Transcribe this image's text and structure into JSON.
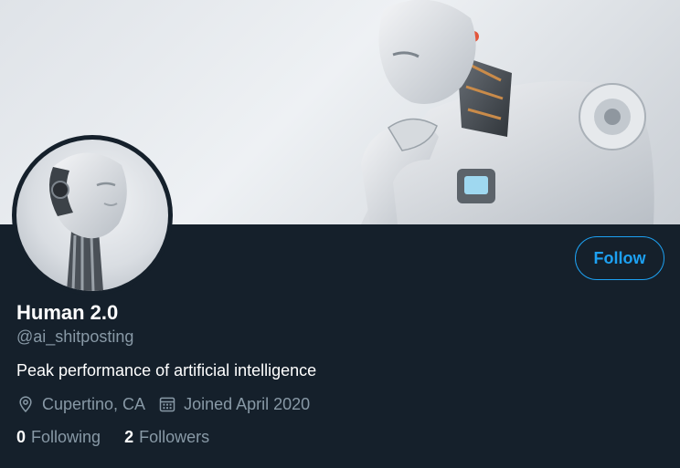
{
  "profile": {
    "display_name": "Human 2.0",
    "handle": "@ai_shitposting",
    "bio": "Peak performance of artificial intelligence",
    "location": "Cupertino, CA",
    "joined": "Joined April 2020"
  },
  "actions": {
    "follow_label": "Follow"
  },
  "stats": {
    "following_count": "0",
    "following_label": "Following",
    "followers_count": "2",
    "followers_label": "Followers"
  },
  "icons": {
    "location": "location-pin-icon",
    "joined": "calendar-icon"
  },
  "colors": {
    "background": "#15202b",
    "accent": "#1da1f2",
    "secondary_text": "#8899a6",
    "primary_text": "#ffffff"
  }
}
